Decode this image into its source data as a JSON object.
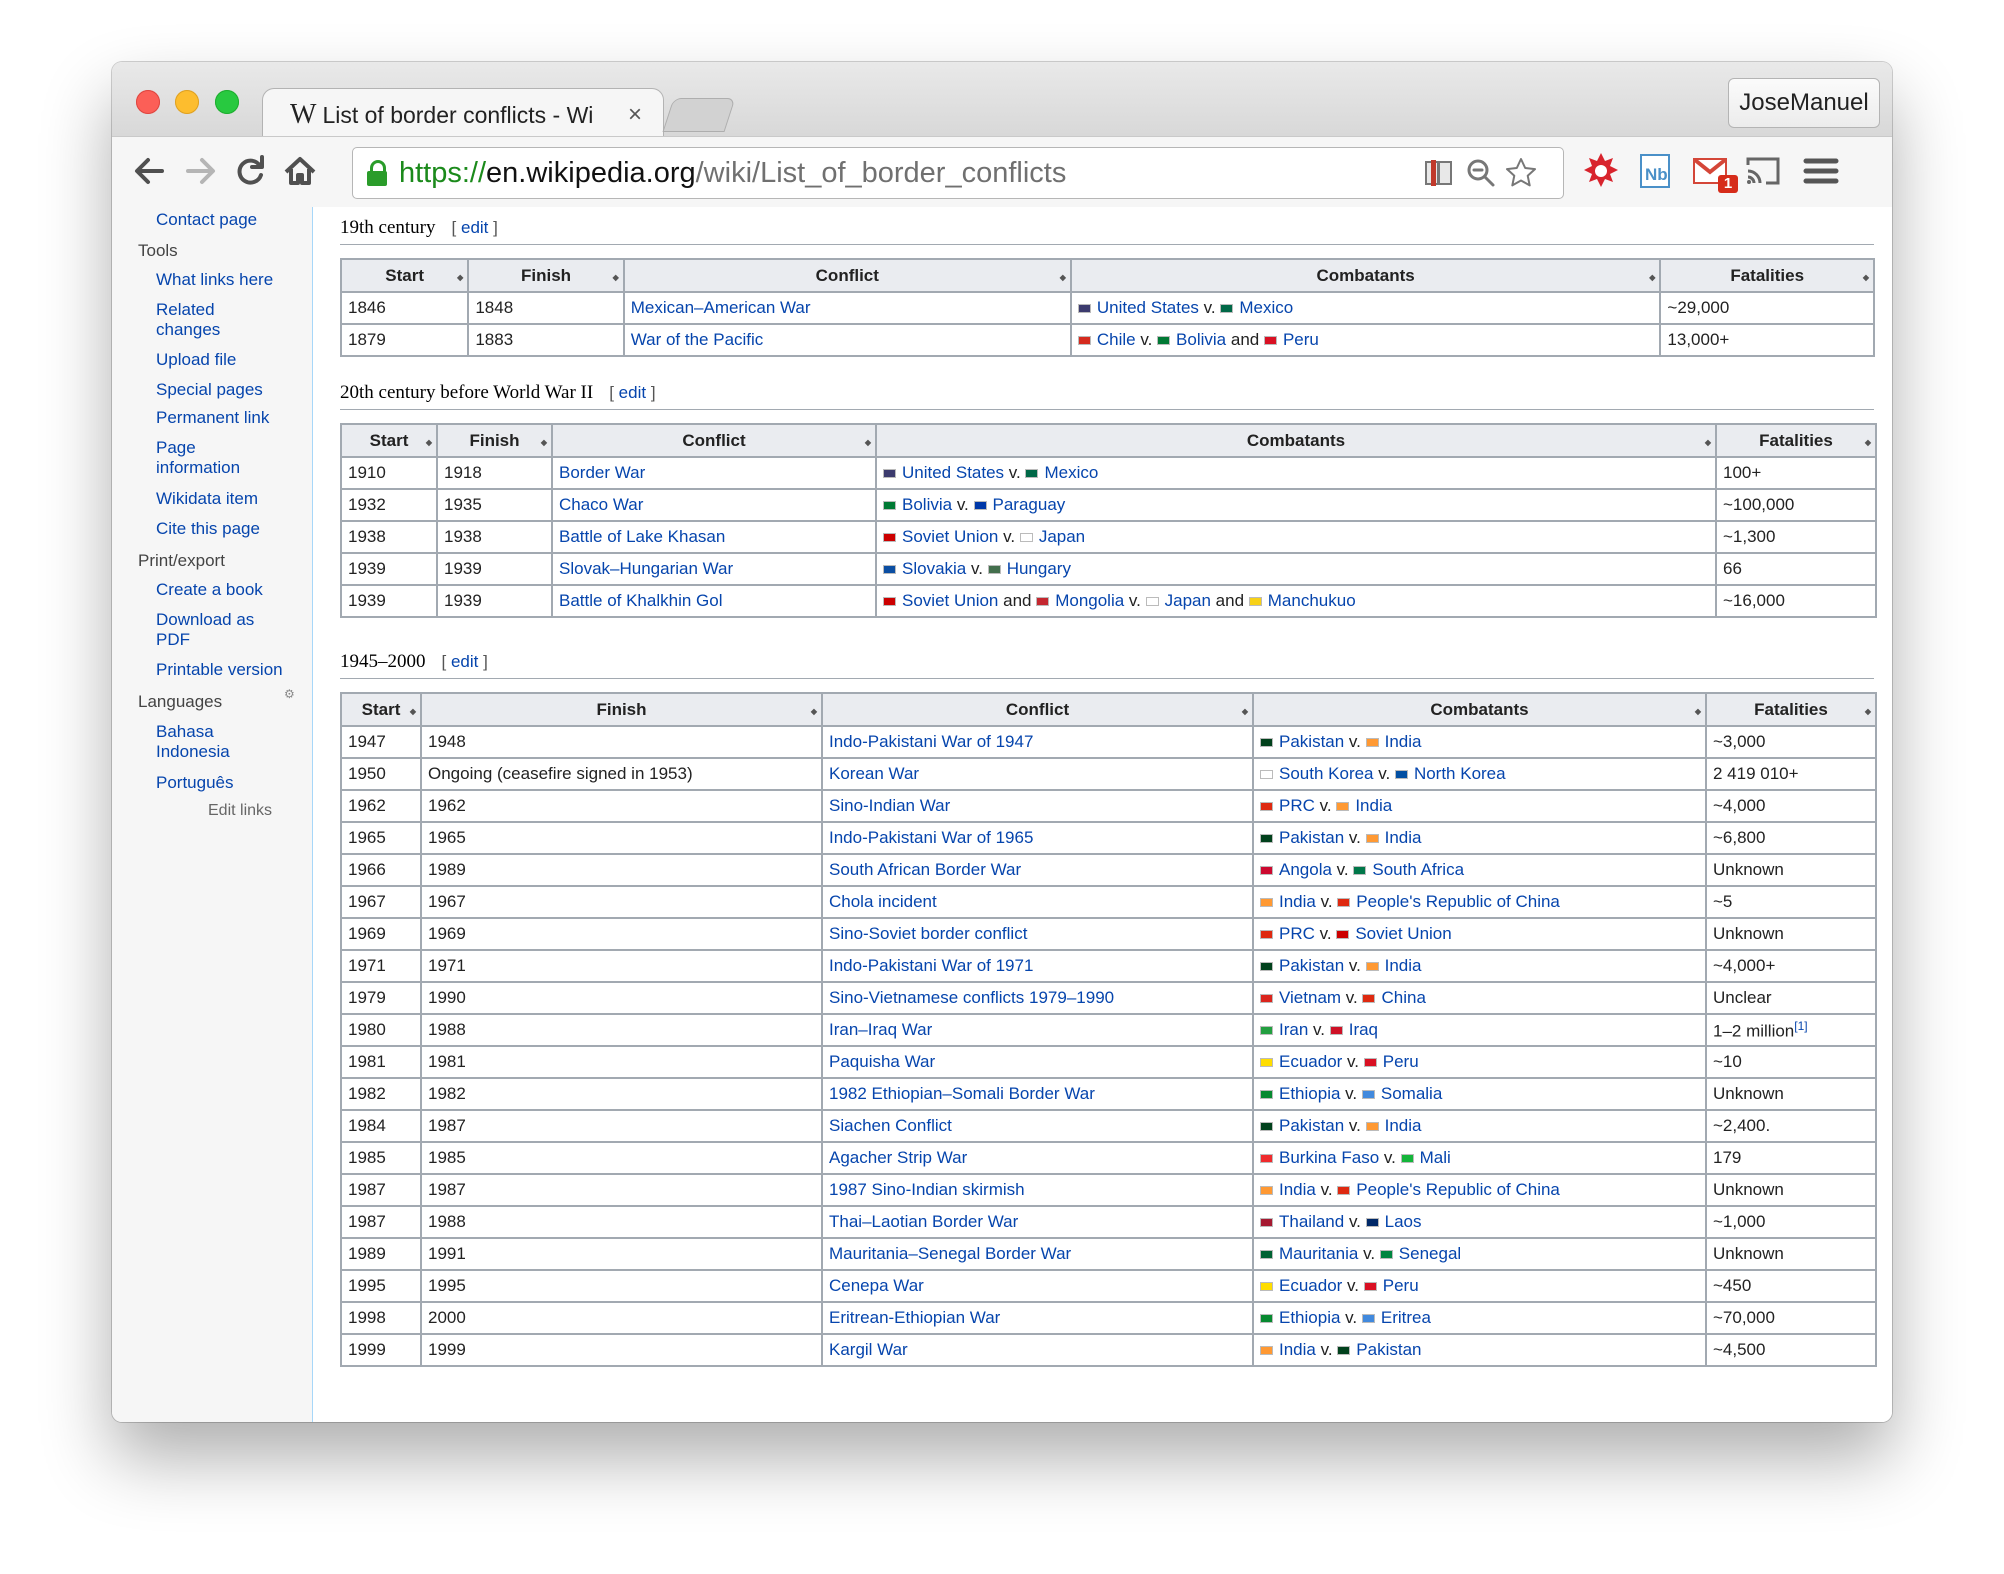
{
  "browser": {
    "tab_title": "List of border conflicts - Wi",
    "tab_logo": "W",
    "tab_close": "×",
    "user": "JoseManuel",
    "url_scheme": "https://",
    "url_host": "en.wikipedia.org",
    "url_path": "/wiki/List_of_border_conflicts",
    "icons": [
      "back-icon",
      "forward-icon",
      "reload-icon",
      "home-icon",
      "lock-icon",
      "reader-icon",
      "zoom-icon",
      "bookmark-star-icon",
      "extension-icon",
      "notebook-icon",
      "gmail-icon",
      "cast-icon",
      "menu-icon"
    ],
    "gmail_badge": "1"
  },
  "sidebar": {
    "contact": "Contact page",
    "tools_heading": "Tools",
    "tools": [
      "What links here",
      "Related changes",
      "Upload file",
      "Special pages",
      "Permanent link",
      "Page information",
      "Wikidata item",
      "Cite this page"
    ],
    "print_heading": "Print/export",
    "print": [
      "Create a book",
      "Download as PDF",
      "Printable version"
    ],
    "languages_heading": "Languages",
    "languages": [
      "Bahasa Indonesia",
      "Português"
    ],
    "edit_links": "Edit links"
  },
  "sections": {
    "s1_title": "19th century",
    "s2_title": "20th century before World War II",
    "s3_title": "1945–2000",
    "edit_open": "[",
    "edit_label": "edit",
    "edit_close": "]"
  },
  "headers": [
    "Start",
    "Finish",
    "Conflict",
    "Combatants",
    "Fatalities"
  ],
  "flag_colors": {
    "us": "#3c3b6e",
    "mx": "#006847",
    "cl": "#d52b1e",
    "bo": "#007934",
    "pe": "#d91023",
    "py": "#0038a8",
    "su": "#cc0000",
    "jp": "#ffffff",
    "sk": "#0b4ea2",
    "hu": "#436f4d",
    "mn": "#c4272f",
    "mk": "#f7d117",
    "pk": "#01411c",
    "in": "#ff9933",
    "kr": "#ffffff",
    "kp": "#024fa2",
    "cn": "#de2910",
    "ao": "#cc092f",
    "za": "#007749",
    "vn": "#da251d",
    "ir": "#239f40",
    "iq": "#ce1126",
    "ec": "#ffdd00",
    "et": "#078930",
    "so": "#4189dd",
    "bf": "#ef2b2d",
    "ml": "#14b53a",
    "th": "#a51931",
    "la": "#002868",
    "mr": "#006233",
    "sn": "#00853f",
    "er": "#4189dd"
  },
  "table1": [
    {
      "start": "1846",
      "finish": "1848",
      "conflict": "Mexican–American War",
      "c": [
        {
          "f": "us",
          "n": "United States"
        },
        {
          "t": "v."
        },
        {
          "f": "mx",
          "n": "Mexico"
        }
      ],
      "fatal": "~29,000"
    },
    {
      "start": "1879",
      "finish": "1883",
      "conflict": "War of the Pacific",
      "c": [
        {
          "f": "cl",
          "n": "Chile"
        },
        {
          "t": "v."
        },
        {
          "f": "bo",
          "n": "Bolivia"
        },
        {
          "t": "and"
        },
        {
          "f": "pe",
          "n": "Peru"
        }
      ],
      "fatal": "13,000+"
    }
  ],
  "table2": [
    {
      "start": "1910",
      "finish": "1918",
      "conflict": "Border War",
      "c": [
        {
          "f": "us",
          "n": "United States"
        },
        {
          "t": "v."
        },
        {
          "f": "mx",
          "n": "Mexico"
        }
      ],
      "fatal": "100+"
    },
    {
      "start": "1932",
      "finish": "1935",
      "conflict": "Chaco War",
      "c": [
        {
          "f": "bo",
          "n": "Bolivia"
        },
        {
          "t": "v."
        },
        {
          "f": "py",
          "n": "Paraguay"
        }
      ],
      "fatal": "~100,000"
    },
    {
      "start": "1938",
      "finish": "1938",
      "conflict": "Battle of Lake Khasan",
      "c": [
        {
          "f": "su",
          "n": "Soviet Union"
        },
        {
          "t": "v."
        },
        {
          "f": "jp",
          "n": "Japan"
        }
      ],
      "fatal": "~1,300"
    },
    {
      "start": "1939",
      "finish": "1939",
      "conflict": "Slovak–Hungarian War",
      "c": [
        {
          "f": "sk",
          "n": "Slovakia"
        },
        {
          "t": "v."
        },
        {
          "f": "hu",
          "n": "Hungary"
        }
      ],
      "fatal": "66"
    },
    {
      "start": "1939",
      "finish": "1939",
      "conflict": "Battle of Khalkhin Gol",
      "c": [
        {
          "f": "su",
          "n": "Soviet Union"
        },
        {
          "t": "and"
        },
        {
          "f": "mn",
          "n": "Mongolia"
        },
        {
          "t": "v."
        },
        {
          "f": "jp",
          "n": "Japan"
        },
        {
          "t": "and"
        },
        {
          "f": "mk",
          "n": "Manchukuo"
        }
      ],
      "fatal": "~16,000"
    }
  ],
  "table3": [
    {
      "start": "1947",
      "finish": "1948",
      "conflict": "Indo-Pakistani War of 1947",
      "c": [
        {
          "f": "pk",
          "n": "Pakistan"
        },
        {
          "t": "v."
        },
        {
          "f": "in",
          "n": "India"
        }
      ],
      "fatal": "~3,000"
    },
    {
      "start": "1950",
      "finish": "Ongoing (ceasefire signed in 1953)",
      "conflict": "Korean War",
      "c": [
        {
          "f": "kr",
          "n": "South Korea"
        },
        {
          "t": "v."
        },
        {
          "f": "kp",
          "n": "North Korea"
        }
      ],
      "fatal": "2 419 010+"
    },
    {
      "start": "1962",
      "finish": "1962",
      "conflict": "Sino-Indian War",
      "c": [
        {
          "f": "cn",
          "n": "PRC"
        },
        {
          "t": "v."
        },
        {
          "f": "in",
          "n": "India"
        }
      ],
      "fatal": "~4,000"
    },
    {
      "start": "1965",
      "finish": "1965",
      "conflict": "Indo-Pakistani War of 1965",
      "c": [
        {
          "f": "pk",
          "n": "Pakistan"
        },
        {
          "t": "v."
        },
        {
          "f": "in",
          "n": "India"
        }
      ],
      "fatal": "~6,800"
    },
    {
      "start": "1966",
      "finish": "1989",
      "conflict": "South African Border War",
      "c": [
        {
          "f": "ao",
          "n": "Angola"
        },
        {
          "t": "v."
        },
        {
          "f": "za",
          "n": "South Africa"
        }
      ],
      "fatal": "Unknown"
    },
    {
      "start": "1967",
      "finish": "1967",
      "conflict": "Chola incident",
      "c": [
        {
          "f": "in",
          "n": "India"
        },
        {
          "t": "v."
        },
        {
          "f": "cn",
          "n": "People's Republic of China"
        }
      ],
      "fatal": "~5"
    },
    {
      "start": "1969",
      "finish": "1969",
      "conflict": "Sino-Soviet border conflict",
      "c": [
        {
          "f": "cn",
          "n": "PRC"
        },
        {
          "t": "v."
        },
        {
          "f": "su",
          "n": "Soviet Union"
        }
      ],
      "fatal": "Unknown"
    },
    {
      "start": "1971",
      "finish": "1971",
      "conflict": "Indo-Pakistani War of 1971",
      "c": [
        {
          "f": "pk",
          "n": "Pakistan"
        },
        {
          "t": "v."
        },
        {
          "f": "in",
          "n": "India"
        }
      ],
      "fatal": "~4,000+"
    },
    {
      "start": "1979",
      "finish": "1990",
      "conflict": "Sino-Vietnamese conflicts 1979–1990",
      "c": [
        {
          "f": "vn",
          "n": "Vietnam"
        },
        {
          "t": "v."
        },
        {
          "f": "cn",
          "n": "China"
        }
      ],
      "fatal": "Unclear"
    },
    {
      "start": "1980",
      "finish": "1988",
      "conflict": "Iran–Iraq War",
      "c": [
        {
          "f": "ir",
          "n": "Iran"
        },
        {
          "t": "v."
        },
        {
          "f": "iq",
          "n": "Iraq"
        }
      ],
      "fatal": "1–2 million",
      "sup": "[1]"
    },
    {
      "start": "1981",
      "finish": "1981",
      "conflict": "Paquisha War",
      "c": [
        {
          "f": "ec",
          "n": "Ecuador"
        },
        {
          "t": "v."
        },
        {
          "f": "pe",
          "n": "Peru"
        }
      ],
      "fatal": "~10"
    },
    {
      "start": "1982",
      "finish": "1982",
      "conflict": "1982 Ethiopian–Somali Border War",
      "c": [
        {
          "f": "et",
          "n": "Ethiopia"
        },
        {
          "t": "v."
        },
        {
          "f": "so",
          "n": "Somalia"
        }
      ],
      "fatal": "Unknown"
    },
    {
      "start": "1984",
      "finish": "1987",
      "conflict": "Siachen Conflict",
      "c": [
        {
          "f": "pk",
          "n": "Pakistan"
        },
        {
          "t": "v."
        },
        {
          "f": "in",
          "n": "India"
        }
      ],
      "fatal": "~2,400."
    },
    {
      "start": "1985",
      "finish": "1985",
      "conflict": "Agacher Strip War",
      "c": [
        {
          "f": "bf",
          "n": "Burkina Faso"
        },
        {
          "t": "v."
        },
        {
          "f": "ml",
          "n": "Mali"
        }
      ],
      "fatal": "179"
    },
    {
      "start": "1987",
      "finish": "1987",
      "conflict": "1987 Sino-Indian skirmish",
      "c": [
        {
          "f": "in",
          "n": "India"
        },
        {
          "t": "v."
        },
        {
          "f": "cn",
          "n": "People's Republic of China"
        }
      ],
      "fatal": "Unknown"
    },
    {
      "start": "1987",
      "finish": "1988",
      "conflict": "Thai–Laotian Border War",
      "c": [
        {
          "f": "th",
          "n": "Thailand"
        },
        {
          "t": "v."
        },
        {
          "f": "la",
          "n": "Laos"
        }
      ],
      "fatal": "~1,000"
    },
    {
      "start": "1989",
      "finish": "1991",
      "conflict": "Mauritania–Senegal Border War",
      "c": [
        {
          "f": "mr",
          "n": "Mauritania"
        },
        {
          "t": "v."
        },
        {
          "f": "sn",
          "n": "Senegal"
        }
      ],
      "fatal": "Unknown"
    },
    {
      "start": "1995",
      "finish": "1995",
      "conflict": "Cenepa War",
      "c": [
        {
          "f": "ec",
          "n": "Ecuador"
        },
        {
          "t": "v."
        },
        {
          "f": "pe",
          "n": "Peru"
        }
      ],
      "fatal": "~450"
    },
    {
      "start": "1998",
      "finish": "2000",
      "conflict": "Eritrean-Ethiopian War",
      "c": [
        {
          "f": "et",
          "n": "Ethiopia"
        },
        {
          "t": "v."
        },
        {
          "f": "er",
          "n": "Eritrea"
        }
      ],
      "fatal": "~70,000"
    },
    {
      "start": "1999",
      "finish": "1999",
      "conflict": "Kargil War",
      "c": [
        {
          "f": "in",
          "n": "India"
        },
        {
          "t": "v."
        },
        {
          "f": "pk",
          "n": "Pakistan"
        }
      ],
      "fatal": "~4,500"
    }
  ]
}
